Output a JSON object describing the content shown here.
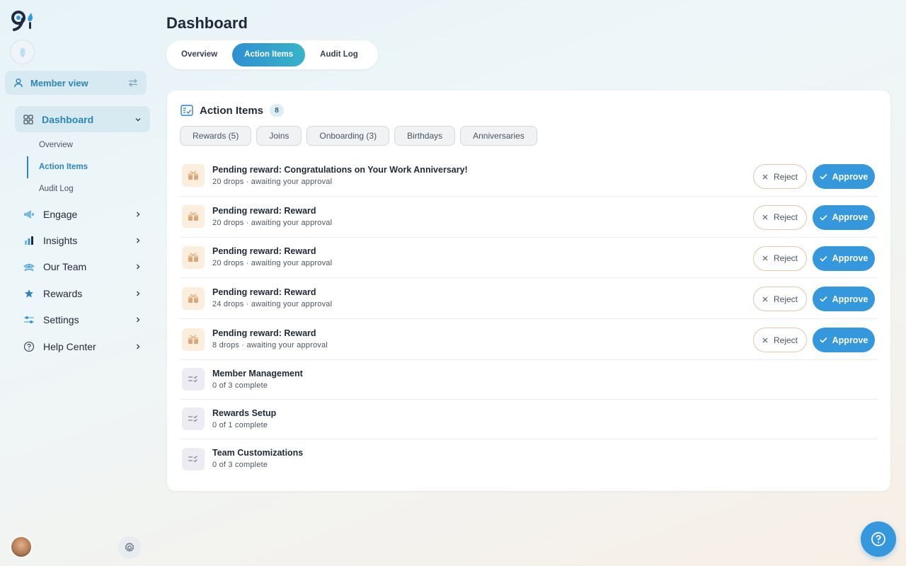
{
  "sidebar": {
    "member_view_label": "Member view",
    "dashboard_label": "Dashboard",
    "subnav": [
      "Overview",
      "Action Items",
      "Audit Log"
    ],
    "items": [
      {
        "label": "Engage",
        "icon": "megaphone-icon"
      },
      {
        "label": "Insights",
        "icon": "bar-chart-icon"
      },
      {
        "label": "Our Team",
        "icon": "team-icon"
      },
      {
        "label": "Rewards",
        "icon": "star-icon"
      },
      {
        "label": "Settings",
        "icon": "sliders-icon"
      },
      {
        "label": "Help Center",
        "icon": "help-circle-icon"
      }
    ]
  },
  "header": {
    "title": "Dashboard",
    "tabs": [
      "Overview",
      "Action Items",
      "Audit Log"
    ],
    "active_tab": "Action Items"
  },
  "card": {
    "title": "Action Items",
    "count": "8",
    "filters": [
      "Rewards (5)",
      "Joins",
      "Onboarding (3)",
      "Birthdays",
      "Anniversaries"
    ],
    "reject_label": "Reject",
    "approve_label": "Approve",
    "rewards": [
      {
        "title": "Pending reward: Congratulations on Your Work Anniversary!",
        "sub": "20 drops · awaiting your approval"
      },
      {
        "title": "Pending reward: Reward",
        "sub": "20 drops · awaiting your approval"
      },
      {
        "title": "Pending reward: Reward",
        "sub": "20 drops · awaiting your approval"
      },
      {
        "title": "Pending reward: Reward",
        "sub": "24 drops · awaiting your approval"
      },
      {
        "title": "Pending reward: Reward",
        "sub": "8 drops · awaiting your approval"
      }
    ],
    "tasks": [
      {
        "title": "Member Management",
        "sub": "0 of 3 complete"
      },
      {
        "title": "Rewards Setup",
        "sub": "0 of 1 complete"
      },
      {
        "title": "Team Customizations",
        "sub": "0 of 3 complete"
      }
    ]
  },
  "colors": {
    "accent": "#3597dc",
    "accent_text": "#2a86b8",
    "nav_active_bg": "#d7e9f1",
    "reward_icon_bg": "#fbeedd",
    "task_icon_bg": "#eeecf3"
  }
}
